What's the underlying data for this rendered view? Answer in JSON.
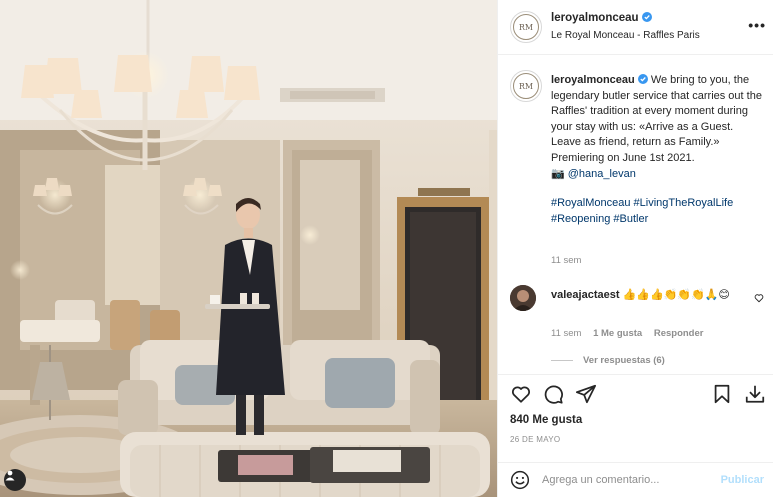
{
  "post": {
    "username": "leroyalmonceau",
    "location": "Le Royal Monceau - Raffles Paris",
    "avatar_initials": "RM",
    "caption": {
      "text": "We bring to you, the legendary butler service that carries out the Raffles' tradition at every moment during your stay with us: «Arrive as a Guest. Leave as friend, return as Family.» Premiering on June 1st 2021.",
      "camera_emoji": "📷",
      "credit": "@hana_levan",
      "hashtags": "#RoyalMonceau #LivingTheRoyalLife #Reopening #Butler",
      "time": "11 sem"
    },
    "comment": {
      "username": "valeajactaest",
      "text": "👍👍👍👏👏👏🙏😊",
      "time": "11 sem",
      "likes": "1 Me gusta",
      "reply": "Responder",
      "view_replies": "Ver respuestas (6)"
    },
    "likes_count": "840 Me gusta",
    "date": "26 DE MAYO",
    "comment_placeholder": "Agrega un comentario...",
    "publish_label": "Publicar",
    "icons": {
      "more": "more-icon",
      "verified": "verified-icon",
      "heart": "heart-icon",
      "comment": "comment-icon",
      "share": "share-icon",
      "save": "bookmark-icon",
      "download": "download-icon",
      "emoji": "emoji-icon",
      "user_tag": "user-tag-icon"
    },
    "colors": {
      "verified": "#3897f0",
      "link": "#00376b",
      "muted": "#8e8e8e",
      "publish_disabled": "#b2dffc"
    }
  }
}
